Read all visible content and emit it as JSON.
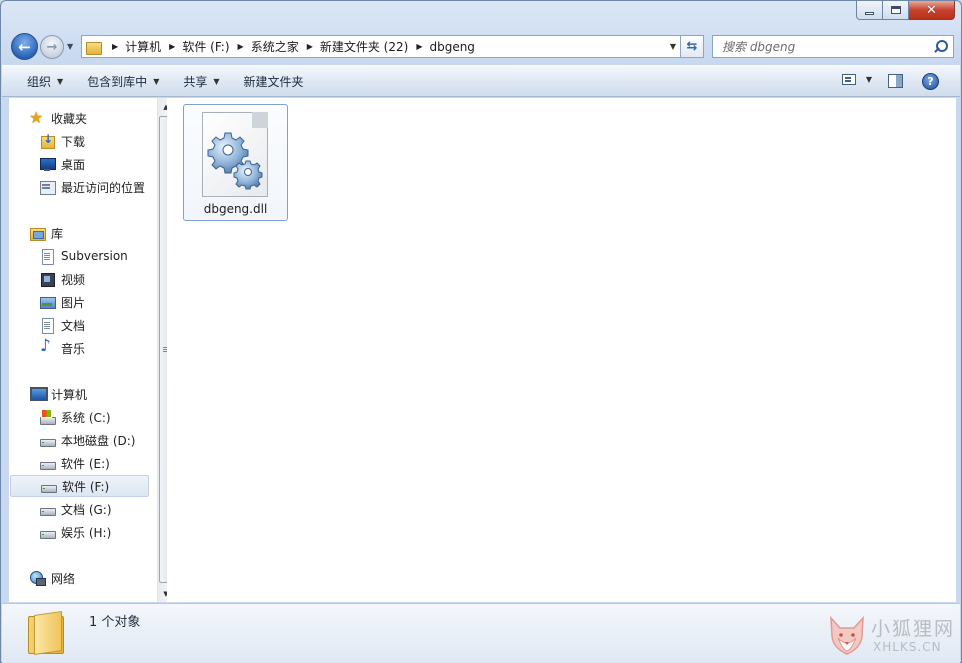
{
  "window": {
    "caption": {
      "minimize": "–",
      "maximize": "□",
      "close": "✕"
    }
  },
  "nav": {
    "back": "←",
    "forward": "→"
  },
  "address": {
    "crumbs": [
      "计算机",
      "软件 (F:)",
      "系统之家",
      "新建文件夹 (22)",
      "dbgeng"
    ]
  },
  "search": {
    "placeholder": "搜索 dbgeng"
  },
  "commands": [
    {
      "label": "组织",
      "dropdown": true
    },
    {
      "label": "包含到库中",
      "dropdown": true
    },
    {
      "label": "共享",
      "dropdown": true
    },
    {
      "label": "新建文件夹",
      "dropdown": false
    }
  ],
  "help": {
    "label": "?"
  },
  "sidebar": {
    "favorites": {
      "label": "收藏夹",
      "icon": "star-icon",
      "items": [
        {
          "label": "下载",
          "icon": "download-icon"
        },
        {
          "label": "桌面",
          "icon": "desktop-icon"
        },
        {
          "label": "最近访问的位置",
          "icon": "recent-icon"
        }
      ]
    },
    "libraries": {
      "label": "库",
      "icon": "library-icon",
      "items": [
        {
          "label": "Subversion",
          "icon": "document-icon"
        },
        {
          "label": "视频",
          "icon": "video-icon"
        },
        {
          "label": "图片",
          "icon": "picture-icon"
        },
        {
          "label": "文档",
          "icon": "document-icon"
        },
        {
          "label": "音乐",
          "icon": "music-icon"
        }
      ]
    },
    "computer": {
      "label": "计算机",
      "icon": "computer-icon",
      "items": [
        {
          "label": "系统 (C:)",
          "icon": "system-drive-icon"
        },
        {
          "label": "本地磁盘 (D:)",
          "icon": "drive-icon"
        },
        {
          "label": "软件 (E:)",
          "icon": "drive-icon"
        },
        {
          "label": "软件 (F:)",
          "icon": "drive-icon",
          "selected": true
        },
        {
          "label": "文档 (G:)",
          "icon": "drive-icon"
        },
        {
          "label": "娱乐 (H:)",
          "icon": "drive-icon"
        }
      ]
    },
    "network": {
      "label": "网络",
      "icon": "network-icon"
    }
  },
  "files": [
    {
      "name": "dbgeng.dll",
      "icon": "dll-file-icon"
    }
  ],
  "details": {
    "count": "1 个对象"
  },
  "watermark": {
    "cn": "小狐狸网",
    "en": "XHLKS.CN"
  },
  "colors": {
    "accent": "#2a64b8",
    "selection_border": "#7da2ce"
  }
}
